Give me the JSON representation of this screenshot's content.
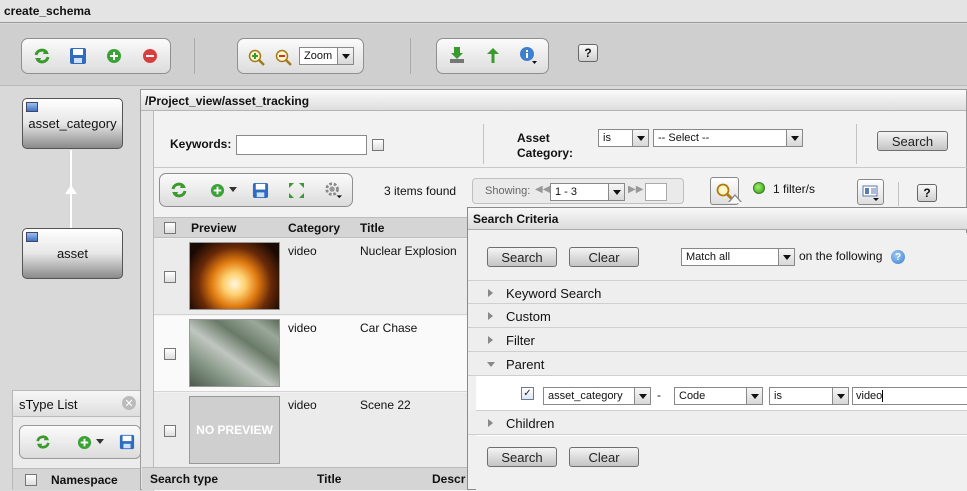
{
  "window": {
    "title": "create_schema"
  },
  "toolbar": {
    "zoom_label": "Zoom",
    "help": "?"
  },
  "schema": {
    "nodes": [
      "asset_category",
      "asset"
    ]
  },
  "stype_list": {
    "title": "sType List",
    "columns": [
      "Namespace",
      "Search type",
      "Title",
      "Descr"
    ]
  },
  "view": {
    "path": "/Project_view/asset_tracking",
    "keywords_label": "Keywords:",
    "keywords_value": "",
    "asset_category_label": "Asset Category:",
    "op_value": "is",
    "select_value": "-- Select --",
    "search_label": "Search",
    "items_found": "3 items found",
    "showing_label": "Showing:",
    "range_value": "1 - 3",
    "filter_count": "1 filter/s",
    "help": "?",
    "columns": {
      "preview": "Preview",
      "category": "Category",
      "title": "Title"
    },
    "rows": [
      {
        "category": "video",
        "title": "Nuclear Explosion"
      },
      {
        "category": "video",
        "title": "Car Chase"
      },
      {
        "category": "video",
        "title": "Scene 22",
        "preview_text": "NO PREVIEW"
      }
    ]
  },
  "search_criteria": {
    "title": "Search Criteria",
    "search_label": "Search",
    "clear_label": "Clear",
    "match_value": "Match all",
    "following_text": "on the following",
    "sections": [
      "Keyword Search",
      "Custom",
      "Filter",
      "Parent",
      "Children"
    ],
    "parent_filter": {
      "column": "asset_category",
      "dash": "-",
      "field": "Code",
      "op": "is",
      "value": "video"
    }
  }
}
